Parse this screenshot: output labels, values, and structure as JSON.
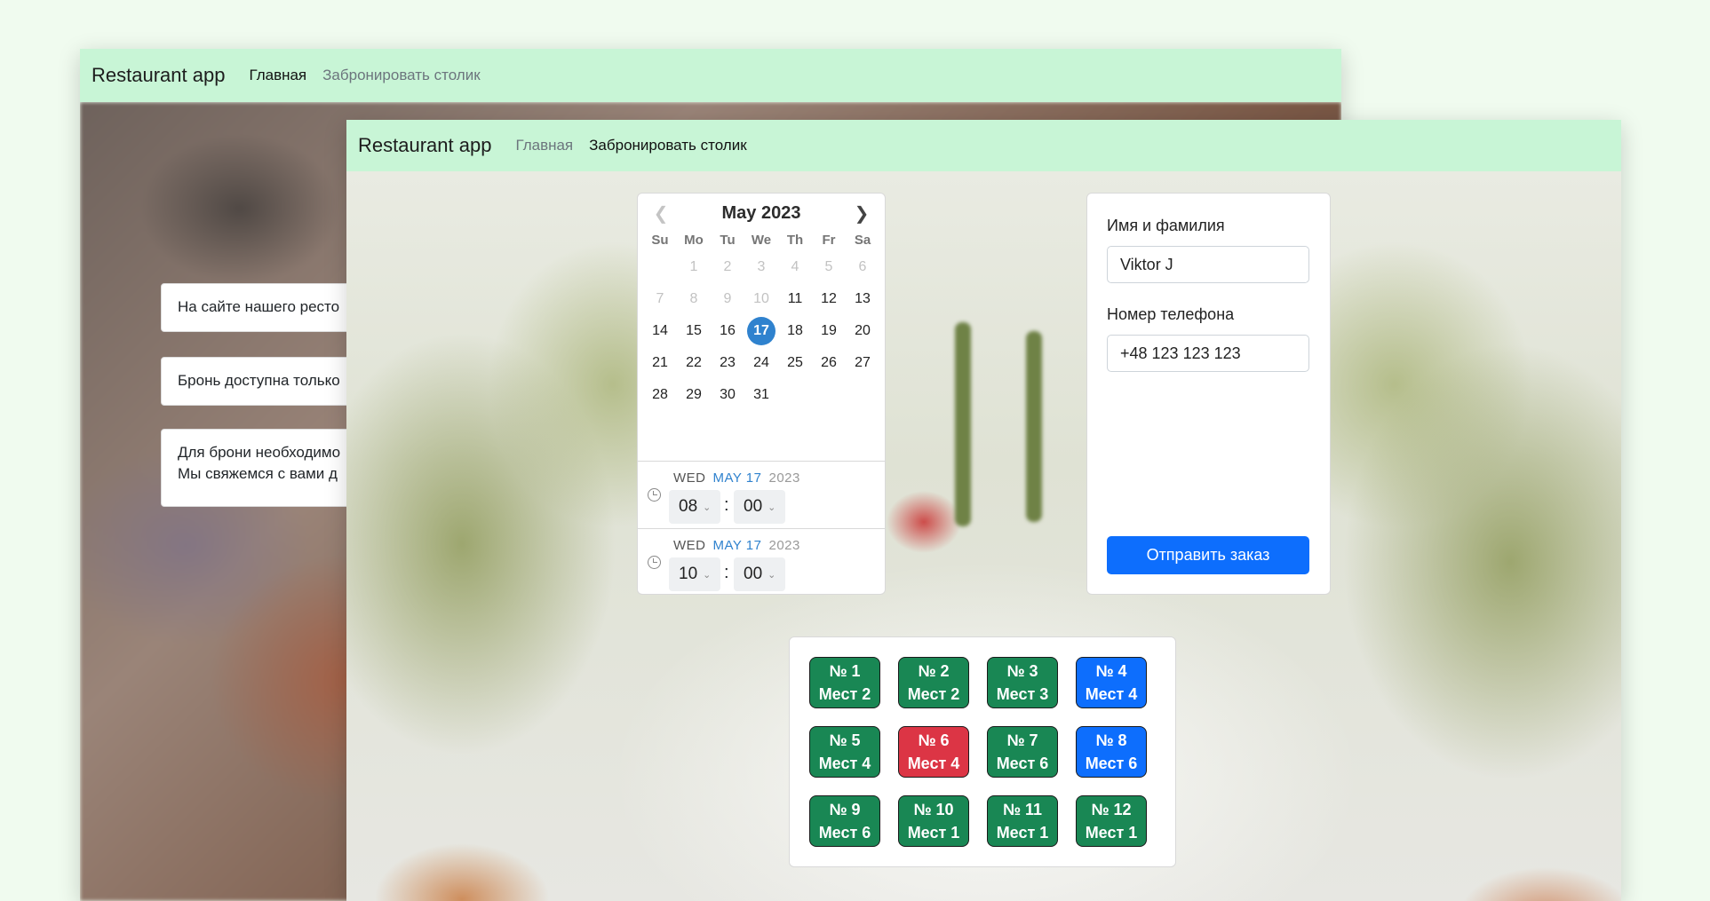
{
  "back": {
    "brand": "Restaurant app",
    "nav": [
      {
        "label": "Главная",
        "active": true
      },
      {
        "label": "Забронировать столик",
        "active": false
      }
    ],
    "cards": [
      "На сайте нашего ресто",
      "Бронь доступна только",
      "Для брони необходимо",
      "Мы свяжемся с вами д"
    ]
  },
  "front": {
    "brand": "Restaurant app",
    "nav": [
      {
        "label": "Главная",
        "active": false
      },
      {
        "label": "Забронировать столик",
        "active": true
      }
    ],
    "calendar": {
      "title": "May 2023",
      "weekdays": [
        "Su",
        "Mo",
        "Tu",
        "We",
        "Th",
        "Fr",
        "Sa"
      ],
      "days": [
        {
          "d": "",
          "muted": true
        },
        {
          "d": "1",
          "muted": true
        },
        {
          "d": "2",
          "muted": true
        },
        {
          "d": "3",
          "muted": true
        },
        {
          "d": "4",
          "muted": true
        },
        {
          "d": "5",
          "muted": true
        },
        {
          "d": "6",
          "muted": true
        },
        {
          "d": "7",
          "muted": true
        },
        {
          "d": "8",
          "muted": true
        },
        {
          "d": "9",
          "muted": true
        },
        {
          "d": "10",
          "muted": true
        },
        {
          "d": "11"
        },
        {
          "d": "12"
        },
        {
          "d": "13"
        },
        {
          "d": "14"
        },
        {
          "d": "15"
        },
        {
          "d": "16"
        },
        {
          "d": "17",
          "selected": true
        },
        {
          "d": "18"
        },
        {
          "d": "19"
        },
        {
          "d": "20"
        },
        {
          "d": "21"
        },
        {
          "d": "22"
        },
        {
          "d": "23"
        },
        {
          "d": "24"
        },
        {
          "d": "25"
        },
        {
          "d": "26"
        },
        {
          "d": "27"
        },
        {
          "d": "28"
        },
        {
          "d": "29"
        },
        {
          "d": "30"
        },
        {
          "d": "31"
        }
      ],
      "times": [
        {
          "weekday": "WED",
          "monthday": "MAY 17",
          "year": "2023",
          "hour": "08",
          "minute": "00",
          "colon": ":"
        },
        {
          "weekday": "WED",
          "monthday": "MAY 17",
          "year": "2023",
          "hour": "10",
          "minute": "00",
          "colon": ":"
        }
      ]
    },
    "form": {
      "name_label": "Имя и фамилия",
      "name_value": "Viktor J",
      "phone_label": "Номер телефона",
      "phone_value": "+48 123 123 123",
      "submit_label": "Отправить заказ"
    },
    "tables": [
      {
        "number": "№ 1",
        "seats": "Мест 2",
        "status": "green"
      },
      {
        "number": "№ 2",
        "seats": "Мест 2",
        "status": "green"
      },
      {
        "number": "№ 3",
        "seats": "Мест 3",
        "status": "green"
      },
      {
        "number": "№ 4",
        "seats": "Мест 4",
        "status": "blue"
      },
      {
        "number": "№ 5",
        "seats": "Мест 4",
        "status": "green"
      },
      {
        "number": "№ 6",
        "seats": "Мест 4",
        "status": "red"
      },
      {
        "number": "№ 7",
        "seats": "Мест 6",
        "status": "green"
      },
      {
        "number": "№ 8",
        "seats": "Мест 6",
        "status": "blue"
      },
      {
        "number": "№ 9",
        "seats": "Мест 6",
        "status": "green"
      },
      {
        "number": "№ 10",
        "seats": "Мест 1",
        "status": "green"
      },
      {
        "number": "№ 11",
        "seats": "Мест 1",
        "status": "green"
      },
      {
        "number": "№ 12",
        "seats": "Мест 1",
        "status": "green"
      }
    ]
  },
  "colors": {
    "navbar": "#c8f5d6",
    "selected_day": "#2f82ce",
    "available_table": "#198754",
    "chosen_table": "#0d6efd",
    "occupied_table": "#dc3545",
    "submit": "#0d6efd"
  },
  "icons": {
    "prev": "chevron-left-icon",
    "next": "chevron-right-icon",
    "clock": "clock-icon",
    "select": "chevron-down-icon"
  }
}
